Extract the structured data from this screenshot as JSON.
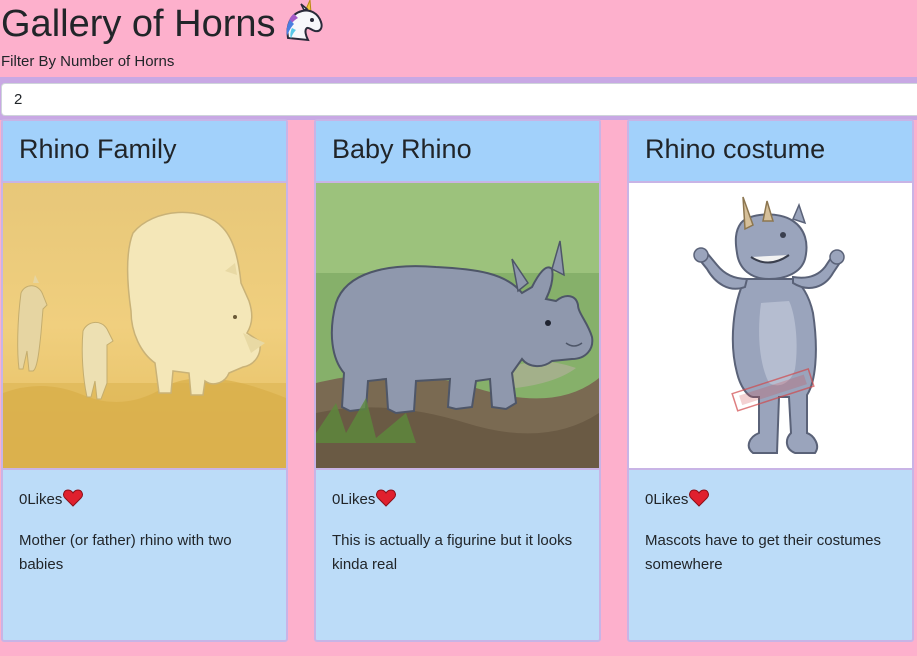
{
  "header": {
    "title": "Gallery of Horns",
    "title_icon": "unicorn-icon",
    "filter_label": "Filter By Number of Horns"
  },
  "filter": {
    "value": "2"
  },
  "cards": [
    {
      "title": "Rhino Family",
      "image_icon": "rhino-family-image",
      "likes": "0Likes",
      "like_icon": "heart-icon",
      "description": "Mother (or father) rhino with two babies"
    },
    {
      "title": "Baby Rhino",
      "image_icon": "baby-rhino-image",
      "likes": "0Likes",
      "like_icon": "heart-icon",
      "description": "This is actually a figurine but it looks kinda real"
    },
    {
      "title": "Rhino costume",
      "image_icon": "rhino-costume-image",
      "likes": "0Likes",
      "like_icon": "heart-icon",
      "description": "Mascots have to get their costumes somewhere"
    }
  ],
  "colors": {
    "page_background": "#fdb0cc",
    "filter_bar": "#c8a8e4",
    "card_header": "#a2d1fb",
    "card_body": "#bcdcf8",
    "card_border": "#c8b4e6",
    "heart": "#e0202e"
  }
}
